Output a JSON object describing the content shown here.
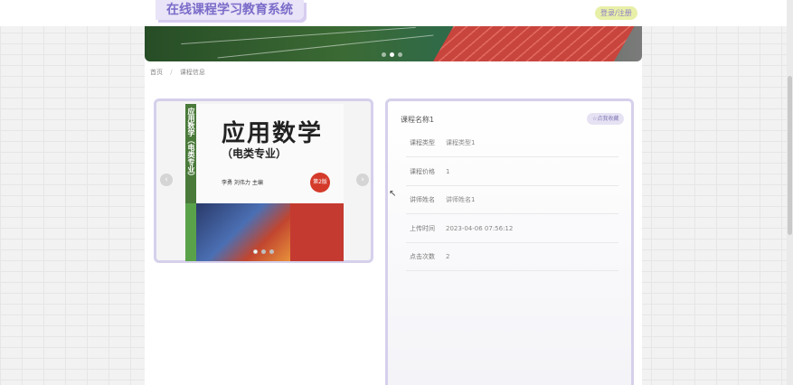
{
  "header": {
    "site_title": "在线课程学习教育系统",
    "login_label": "登录/注册"
  },
  "breadcrumb": {
    "home": "首页",
    "current": "课程信息"
  },
  "gallery": {
    "book_title": "应用数学",
    "book_subtitle": "（电类专业）",
    "spine_text": "应用数学（电类专业）",
    "authors": "李勇 刘伟力 主编",
    "edition_badge": "第2版",
    "prev_arrow": "‹",
    "next_arrow": "›"
  },
  "course": {
    "name": "课程名称1",
    "favorite_label": "☆点我收藏",
    "fields": [
      {
        "label": "课程类型",
        "value": "课程类型1"
      },
      {
        "label": "课程价格",
        "value": "1"
      },
      {
        "label": "讲师姓名",
        "value": "讲师姓名1"
      },
      {
        "label": "上传时间",
        "value": "2023-04-06 07:56:12"
      },
      {
        "label": "点击次数",
        "value": "2"
      }
    ]
  },
  "banner": {
    "slides": 3,
    "active_slide": 2
  },
  "colors": {
    "accent": "#7b6cc9",
    "panel_border": "#d6d0ec",
    "login_bg": "#e8f0a8"
  }
}
